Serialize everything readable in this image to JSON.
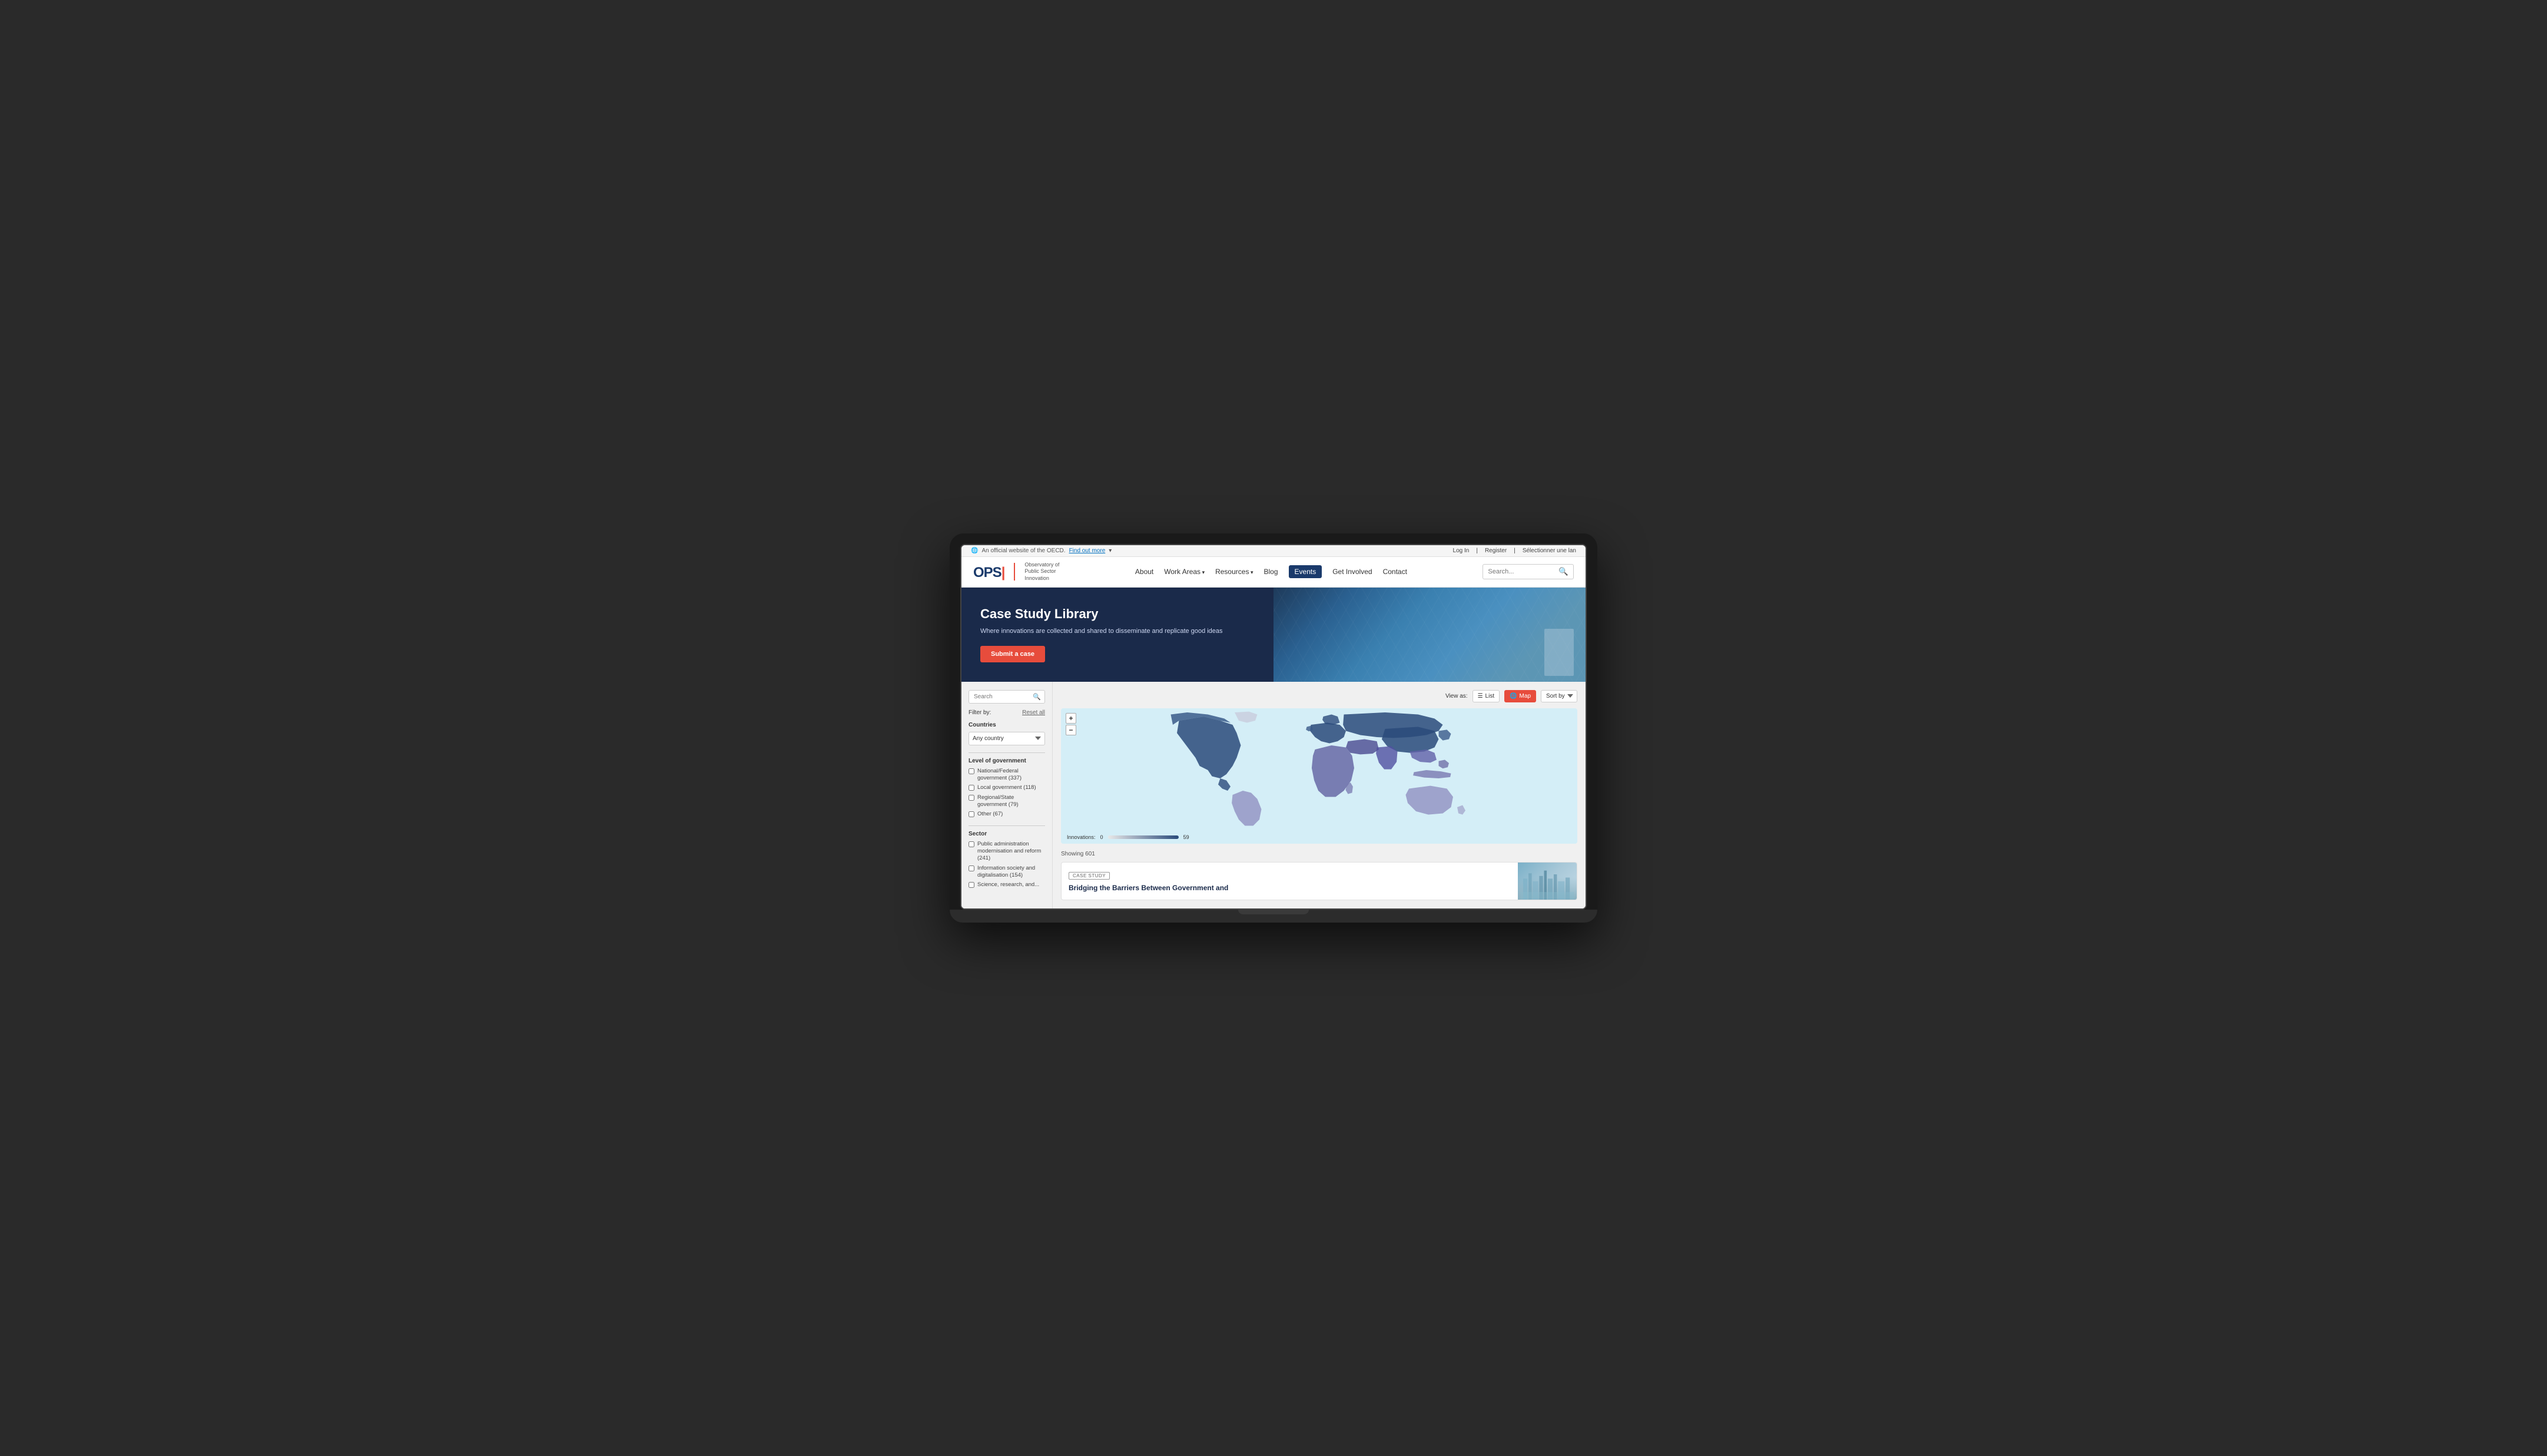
{
  "topbar": {
    "official_text": "An official website of the OECD.",
    "find_out_more": "Find out more",
    "login": "Log In",
    "register": "Register",
    "language": "Sélectionner une lan"
  },
  "nav": {
    "logo_opsi": "OPS|",
    "logo_subtitle_line1": "Observatory of",
    "logo_subtitle_line2": "Public Sector",
    "logo_subtitle_line3": "Innovation",
    "links": [
      {
        "label": "About",
        "active": false,
        "has_arrow": false
      },
      {
        "label": "Work Areas",
        "active": false,
        "has_arrow": true
      },
      {
        "label": "Resources",
        "active": false,
        "has_arrow": true
      },
      {
        "label": "Blog",
        "active": false,
        "has_arrow": false
      },
      {
        "label": "Events",
        "active": true,
        "has_arrow": false
      },
      {
        "label": "Get Involved",
        "active": false,
        "has_arrow": false
      },
      {
        "label": "Contact",
        "active": false,
        "has_arrow": false
      }
    ],
    "search_placeholder": "Search..."
  },
  "hero": {
    "title": "Case Study Library",
    "subtitle": "Where innovations are collected and shared to disseminate and replicate good ideas",
    "cta_button": "Submit a case"
  },
  "sidebar": {
    "search_placeholder": "Search",
    "filter_label": "Filter by:",
    "reset_label": "Reset all",
    "countries_label": "Countries",
    "country_default": "Any country",
    "level_of_government_label": "Level of government",
    "level_checkboxes": [
      {
        "label": "National/Federal government (337)",
        "checked": false
      },
      {
        "label": "Local government (118)",
        "checked": false
      },
      {
        "label": "Regional/State government (79)",
        "checked": false
      },
      {
        "label": "Other (67)",
        "checked": false
      }
    ],
    "sector_label": "Sector",
    "sector_checkboxes": [
      {
        "label": "Public administration modernisation and reform (241)",
        "checked": false
      },
      {
        "label": "Information society and digitalisation (154)",
        "checked": false
      },
      {
        "label": "Science, research, and...",
        "checked": false
      }
    ]
  },
  "content": {
    "view_as_label": "View as:",
    "list_label": "List",
    "map_label": "Map",
    "sort_by_label": "Sort by",
    "map_legend_label": "Innovations:",
    "map_legend_min": "0",
    "map_legend_max": "59",
    "showing_label": "Showing 601",
    "card": {
      "badge": "CASE STUDY",
      "title": "Bridging the Barriers Between Government and"
    }
  }
}
